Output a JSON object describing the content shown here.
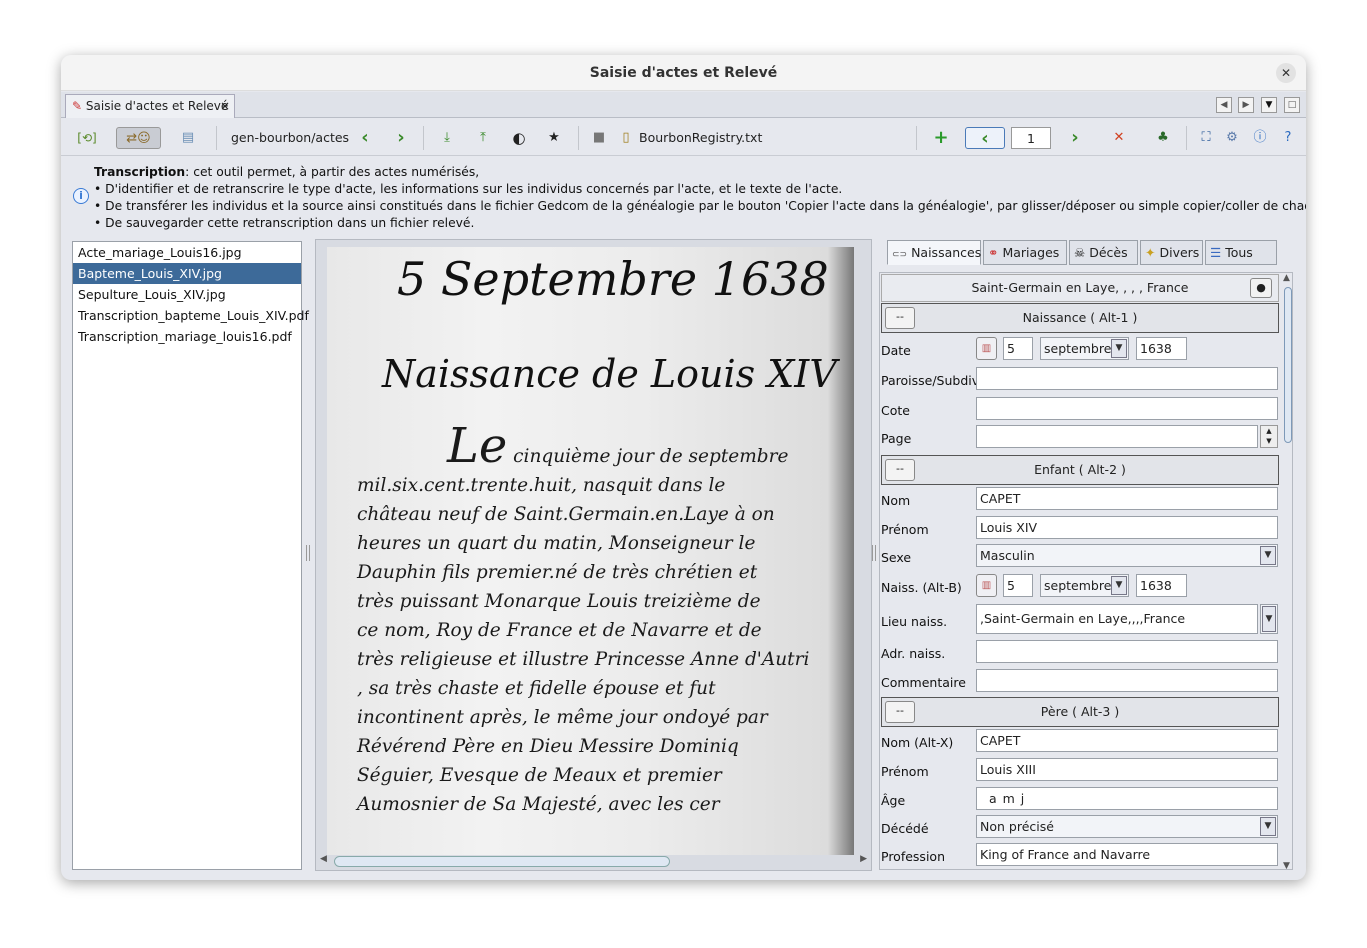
{
  "window": {
    "title": "Saisie d'actes et Relevé",
    "close_glyph": "✕"
  },
  "tab": {
    "label": "Saisie d'actes et Relevé",
    "close_glyph": "×"
  },
  "toolbar": {
    "path": "gen-bourbon/actes",
    "registry_file": "BourbonRegistry.txt",
    "page_number": "1"
  },
  "info": {
    "title_bold": "Transcription",
    "title_rest": ": cet outil permet, à partir des actes numérisés,",
    "line1": "• D'identifier et de retranscrire le type d'acte, les informations sur les individus concernés par l'acte, et le texte de l'acte.",
    "line2": "• De transférer les individus et la source ainsi constitués dans le fichier Gedcom de la généalogie par le bouton 'Copier l'acte dans la généalogie', par glisser/déposer ou simple copier/coller de chaque information.",
    "line3": "• De sauvegarder cette retranscription dans un fichier relevé."
  },
  "files": {
    "items": [
      "Acte_mariage_Louis16.jpg",
      "Bapteme_Louis_XIV.jpg",
      "Sepulture_Louis_XIV.jpg",
      "Transcription_bapteme_Louis_XIV.pdf",
      "Transcription_mariage_louis16.pdf"
    ],
    "selected_index": 1
  },
  "manuscript": {
    "heading_date": "5 Septembre 1638",
    "heading_title": "Naissance de Louis XIV",
    "initial": "Le",
    "lines": [
      "cinquième jour de septembre",
      "mil.six.cent.trente.huit, nasquit dans le",
      "château neuf de Saint.Germain.en.Laye à on",
      "heures un quart du matin, Monseigneur le",
      "Dauphin fils premier.né de très chrétien et",
      "très puissant Monarque Louis treizième de",
      "ce nom, Roy de France et de Navarre et de",
      "très religieuse et illustre Princesse Anne d'Autri",
      ", sa très chaste et fidelle épouse et fut",
      "incontinent après, le même jour ondoyé par",
      "Révérend Père en Dieu Messire Dominiq",
      "Séguier, Evesque de Meaux et premier",
      "Aumosnier de Sa Majesté, avec les cer"
    ]
  },
  "right_tabs": [
    "Naissances",
    "Mariages",
    "Décès",
    "Divers",
    "Tous"
  ],
  "form": {
    "place": "Saint-Germain en Laye, , , , France",
    "naissance_section": "Naissance  ( Alt-1 )",
    "date_label": "Date",
    "date_day": "5",
    "date_month": "septembre",
    "date_year": "1638",
    "paroisse_label": "Paroisse/Subdiv.",
    "cote_label": "Cote",
    "page_label": "Page",
    "enfant_section": "Enfant  ( Alt-2 )",
    "nom_label": "Nom",
    "nom_value": "CAPET",
    "prenom_label": "Prénom",
    "prenom_value": "Louis XIV",
    "sexe_label": "Sexe",
    "sexe_value": "Masculin",
    "naiss_label": "Naiss. (Alt-B)",
    "naiss_day": "5",
    "naiss_month": "septembre",
    "naiss_year": "1638",
    "lieu_label": "Lieu naiss.",
    "lieu_value": ",Saint-Germain en Laye,,,,France",
    "adr_label": "Adr. naiss.",
    "comment_label": "Commentaire",
    "pere_section": "Père  ( Alt-3 )",
    "pere_nom_label": "Nom (Alt-X)",
    "pere_nom_value": "CAPET",
    "pere_prenom_label": "Prénom",
    "pere_prenom_value": "Louis XIII",
    "age_label": "Âge",
    "age_value": "a   m   j",
    "decede_label": "Décédé",
    "decede_value": "Non précisé",
    "profession_label": "Profession",
    "profession_value": "King of France and Navarre",
    "mini_button": "--"
  }
}
